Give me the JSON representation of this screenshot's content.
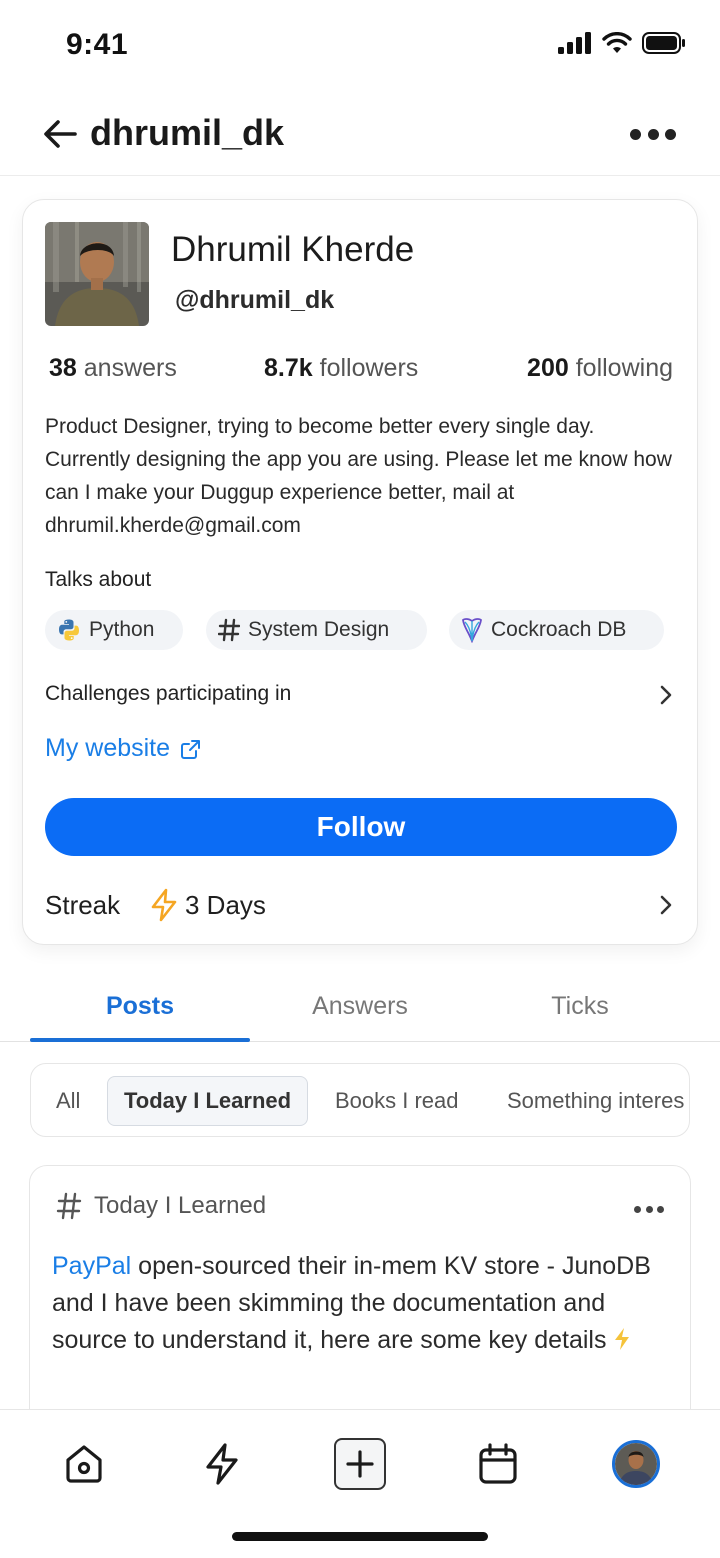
{
  "status_bar": {
    "time": "9:41",
    "icons": [
      "signal-icon",
      "wifi-icon",
      "battery-icon"
    ]
  },
  "header": {
    "title": "dhrumil_dk",
    "back_icon": "arrow-left-icon",
    "more_icon": "more-horizontal-icon"
  },
  "profile": {
    "name": "Dhrumil Kherde",
    "handle": "@dhrumil_dk",
    "stats": {
      "answers_count": "38",
      "answers_label": "answers",
      "followers_count": "8.7k",
      "followers_label": "followers",
      "following_count": "200",
      "following_label": "following"
    },
    "bio": "Product Designer, trying to become better every single day. Currently designing the app you are using. Please let me know how can I make your Duggup experience better, mail at dhrumil.kherde@gmail.com",
    "talks_about_label": "Talks about",
    "topics": [
      {
        "label": "Python",
        "icon": "python-icon"
      },
      {
        "label": "System Design",
        "icon": "hash-icon"
      },
      {
        "label": "Cockroach DB",
        "icon": "cockroachdb-icon"
      }
    ],
    "challenges_label": "Challenges participating in",
    "website_label": "My website",
    "follow_label": "Follow",
    "streak_label": "Streak",
    "streak_value": "3 Days"
  },
  "tabs": [
    {
      "label": "Posts",
      "active": true
    },
    {
      "label": "Answers",
      "active": false
    },
    {
      "label": "Ticks",
      "active": false
    }
  ],
  "filters": [
    {
      "label": "All",
      "selected": false
    },
    {
      "label": "Today I Learned",
      "selected": true
    },
    {
      "label": "Books I read",
      "selected": false
    },
    {
      "label": "Something interes",
      "selected": false
    }
  ],
  "post": {
    "category": "Today I Learned",
    "link_text": "PayPal",
    "body": " open-sourced their in-mem KV store - JunoDB and I have been skimming the documentation and source to understand it, here are some key details"
  },
  "bottom_nav": [
    "home-icon",
    "bolt-icon",
    "add-icon",
    "calendar-icon",
    "profile-avatar"
  ],
  "colors": {
    "accent": "#0b6cf5",
    "link": "#1a7ee6",
    "streak": "#f5a623"
  }
}
